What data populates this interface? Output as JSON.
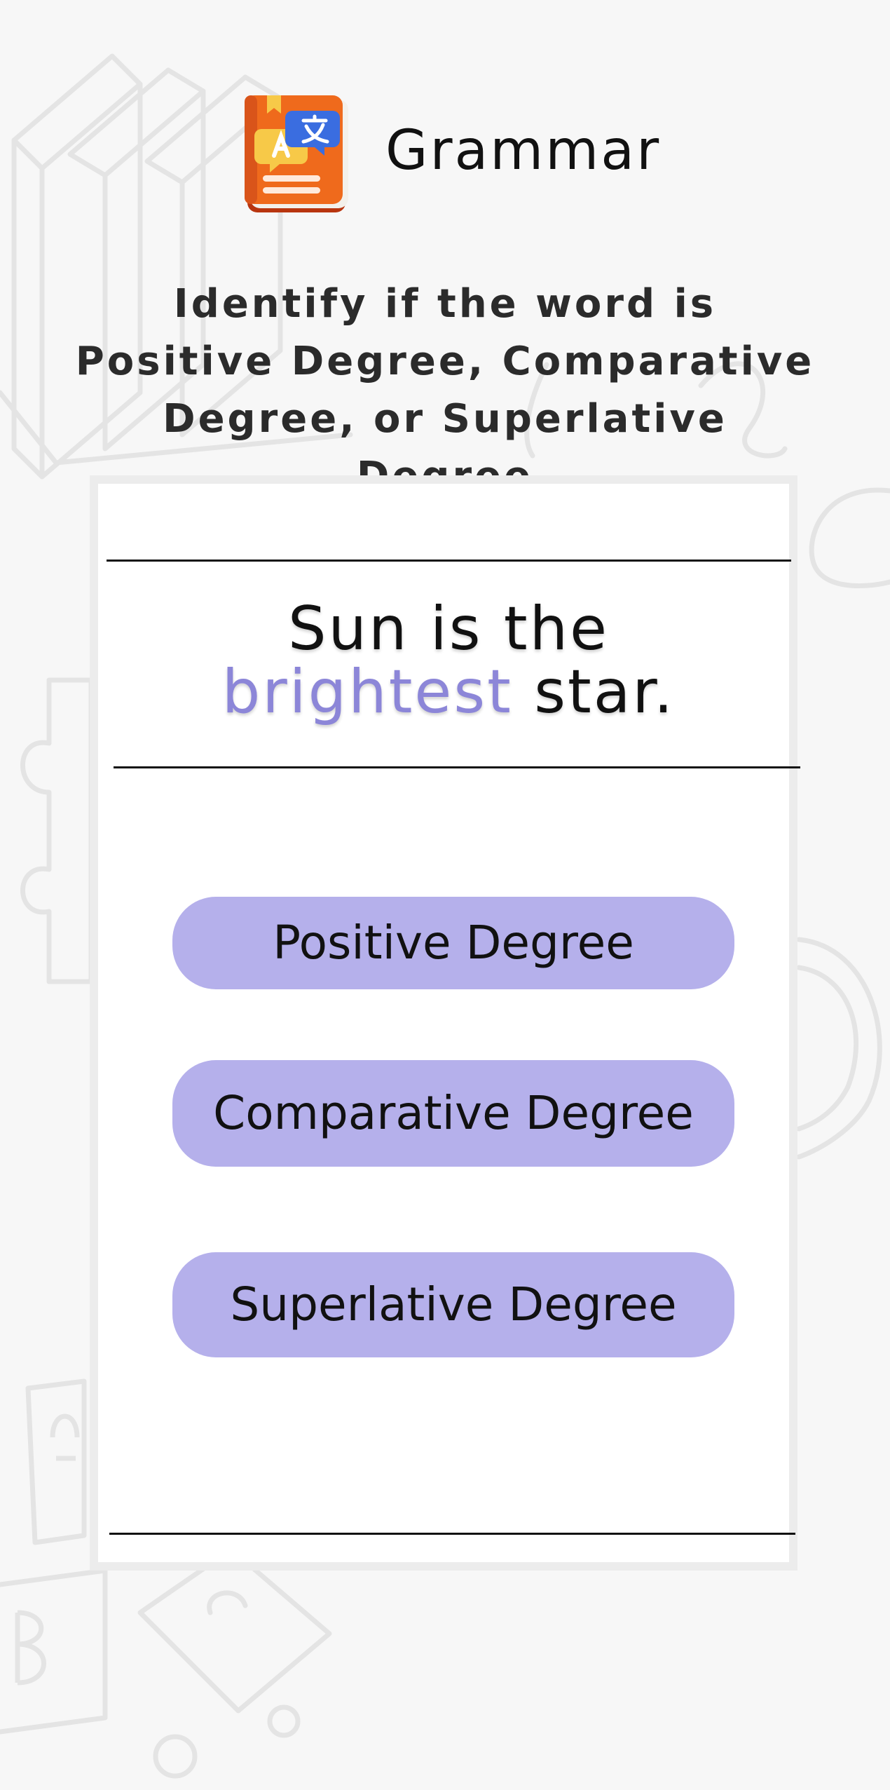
{
  "header": {
    "title": "Grammar",
    "icon": "grammar-book-icon"
  },
  "instruction": {
    "text": "Identify if the word is Positive Degree, Comparative Degree, or Superlative Degree"
  },
  "question": {
    "before": "Sun is the ",
    "keyword": "brightest",
    "after": " star."
  },
  "options": [
    {
      "label": "Positive Degree"
    },
    {
      "label": "Comparative Degree"
    },
    {
      "label": "Superlative Degree"
    }
  ],
  "colors": {
    "background": "#f7f7f7",
    "card": "#ffffff",
    "card_border": "#ececec",
    "option_fill": "#b5b0eb",
    "keyword": "#8c86d8",
    "icon_book": "#ef6a1c"
  }
}
